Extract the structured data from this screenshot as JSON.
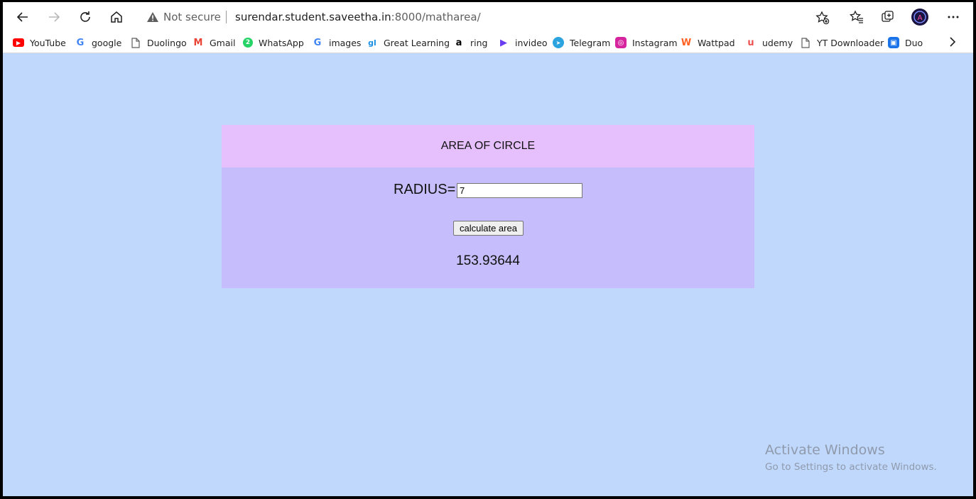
{
  "browser": {
    "security_label": "Not secure",
    "url_host": "surendar.student.saveetha.in",
    "url_path": ":8000/matharea/",
    "icons": [
      "back-icon",
      "forward-icon",
      "refresh-icon",
      "home-icon",
      "warning-icon",
      "add-favorite-icon",
      "favorites-icon",
      "collections-icon",
      "profile-avatar",
      "more-menu-icon"
    ]
  },
  "bookmarks": [
    {
      "label": "YouTube",
      "icon": "youtube-icon",
      "color": "#ff0000",
      "glyph": "▶"
    },
    {
      "label": "google",
      "icon": "google-icon",
      "color": "#4285f4",
      "glyph": "G"
    },
    {
      "label": "Duolingo",
      "icon": "page-icon",
      "color": "#5f5f5f",
      "glyph": ""
    },
    {
      "label": "Gmail",
      "icon": "gmail-icon",
      "color": "#ea4335",
      "glyph": "M"
    },
    {
      "label": "WhatsApp",
      "icon": "whatsapp-icon",
      "color": "#25d366",
      "glyph": "2"
    },
    {
      "label": "images",
      "icon": "google-icon",
      "color": "#4285f4",
      "glyph": "G"
    },
    {
      "label": "Great Learning",
      "icon": "greatlearning-icon",
      "color": "#1a8fe3",
      "glyph": "gl"
    },
    {
      "label": "ring",
      "icon": "amazon-icon",
      "color": "#000000",
      "glyph": "a"
    },
    {
      "label": "invideo",
      "icon": "invideo-icon",
      "color": "#6a3cf0",
      "glyph": "▶"
    },
    {
      "label": "Telegram",
      "icon": "telegram-icon",
      "color": "#2aa3df",
      "glyph": "➤"
    },
    {
      "label": "Instagram",
      "icon": "instagram-icon",
      "color": "#d6249f",
      "glyph": "◎"
    },
    {
      "label": "Wattpad",
      "icon": "wattpad-icon",
      "color": "#ff6122",
      "glyph": "W"
    },
    {
      "label": "udemy",
      "icon": "udemy-icon",
      "color": "#ec5252",
      "glyph": "u"
    },
    {
      "label": "YT Downloader",
      "icon": "page-icon",
      "color": "#5f5f5f",
      "glyph": ""
    },
    {
      "label": "Duo",
      "icon": "duo-icon",
      "color": "#1a73e8",
      "glyph": "▣"
    }
  ],
  "page": {
    "heading": "AREA OF CIRCLE",
    "radius_label": "RADIUS=",
    "radius_value": "7",
    "calculate_label": "calculate area",
    "result": "153.93644"
  },
  "watermark": {
    "title": "Activate Windows",
    "subtitle": "Go to Settings to activate Windows."
  },
  "colors": {
    "page_bg": "#c0d8fc",
    "header_bg": "#e6c0fc",
    "body_bg": "#c6befc"
  }
}
